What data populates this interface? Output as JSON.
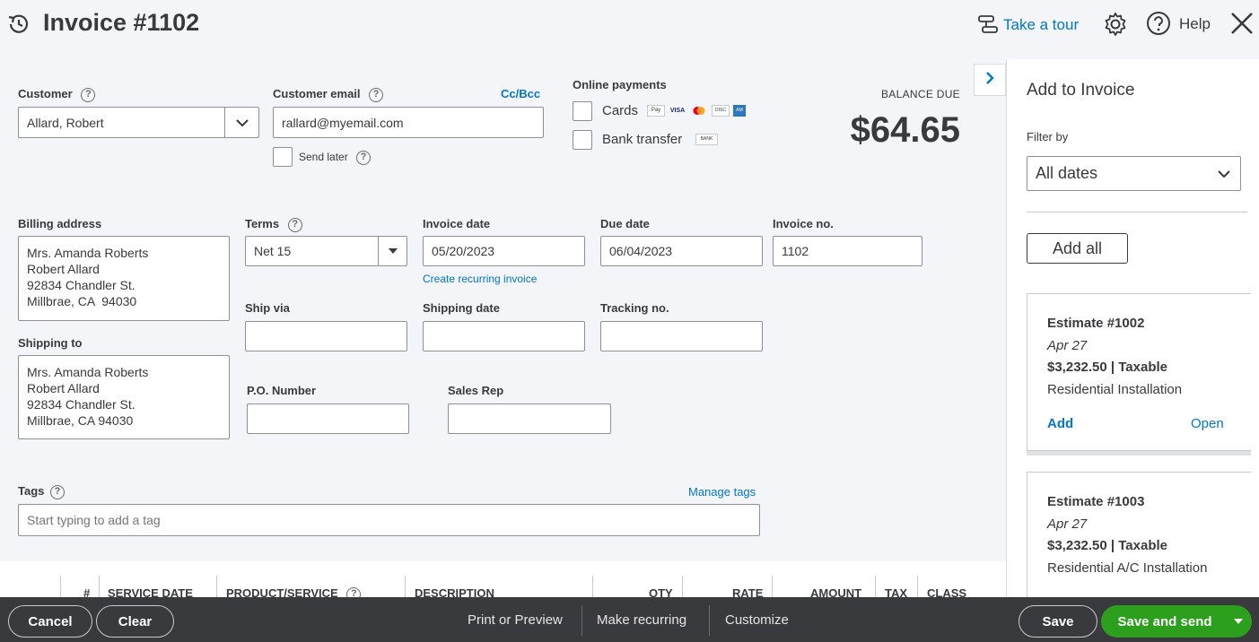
{
  "header": {
    "title": "Invoice #1102",
    "take_tour": "Take a tour",
    "help": "Help"
  },
  "customer": {
    "label": "Customer",
    "value": "Allard, Robert"
  },
  "email": {
    "label": "Customer email",
    "cc_bcc": "Cc/Bcc",
    "value": "rallard@myemail.com",
    "send_later": "Send later"
  },
  "online_payments": {
    "label": "Online payments",
    "cards": "Cards",
    "bank_transfer": "Bank transfer",
    "bank_badge": "BANK",
    "card_badges": [
      "Pay",
      "VISA",
      "",
      "DISC",
      "AM"
    ]
  },
  "balance": {
    "label": "BALANCE DUE",
    "amount": "$64.65"
  },
  "billing": {
    "label": "Billing address",
    "lines": [
      "Mrs. Amanda Roberts",
      "Robert Allard",
      "92834 Chandler St.",
      "Millbrae, CA  94030"
    ]
  },
  "shipping": {
    "label": "Shipping to",
    "lines": [
      "Mrs. Amanda Roberts",
      "Robert Allard",
      "92834 Chandler St.",
      "Millbrae, CA 94030"
    ]
  },
  "terms": {
    "label": "Terms",
    "value": "Net 15"
  },
  "invoice_date": {
    "label": "Invoice date",
    "value": "05/20/2023",
    "recurring_link": "Create recurring invoice"
  },
  "due_date": {
    "label": "Due date",
    "value": "06/04/2023"
  },
  "invoice_no": {
    "label": "Invoice no.",
    "value": "1102"
  },
  "ship_via": {
    "label": "Ship via",
    "value": ""
  },
  "shipping_date": {
    "label": "Shipping date",
    "value": ""
  },
  "tracking_no": {
    "label": "Tracking no.",
    "value": ""
  },
  "po_number": {
    "label": "P.O. Number",
    "value": ""
  },
  "sales_rep": {
    "label": "Sales Rep",
    "value": ""
  },
  "tags": {
    "label": "Tags",
    "manage": "Manage tags",
    "placeholder": "Start typing to add a tag"
  },
  "table": {
    "columns": [
      "#",
      "SERVICE DATE",
      "PRODUCT/SERVICE",
      "DESCRIPTION",
      "QTY",
      "RATE",
      "AMOUNT",
      "TAX",
      "CLASS"
    ]
  },
  "side_panel": {
    "title": "Add to Invoice",
    "filter_label": "Filter by",
    "filter_value": "All dates",
    "add_all": "Add all",
    "cards": [
      {
        "title": "Estimate #1002",
        "date": "Apr 27",
        "amount": "$3,232.50 | Taxable",
        "product": "Residential Installation",
        "add": "Add",
        "open": "Open"
      },
      {
        "title": "Estimate #1003",
        "date": "Apr 27",
        "amount": "$3,232.50 | Taxable",
        "product": "Residential A/C Installation"
      }
    ]
  },
  "footer": {
    "cancel": "Cancel",
    "clear": "Clear",
    "print_preview": "Print or Preview",
    "make_recurring": "Make recurring",
    "customize": "Customize",
    "save": "Save",
    "save_and_send": "Save and send"
  },
  "colors": {
    "link": "#0077c5",
    "primary_green": "#2ca01c",
    "footer_bg": "#393a3d",
    "page_bg": "#f4f5f8"
  }
}
